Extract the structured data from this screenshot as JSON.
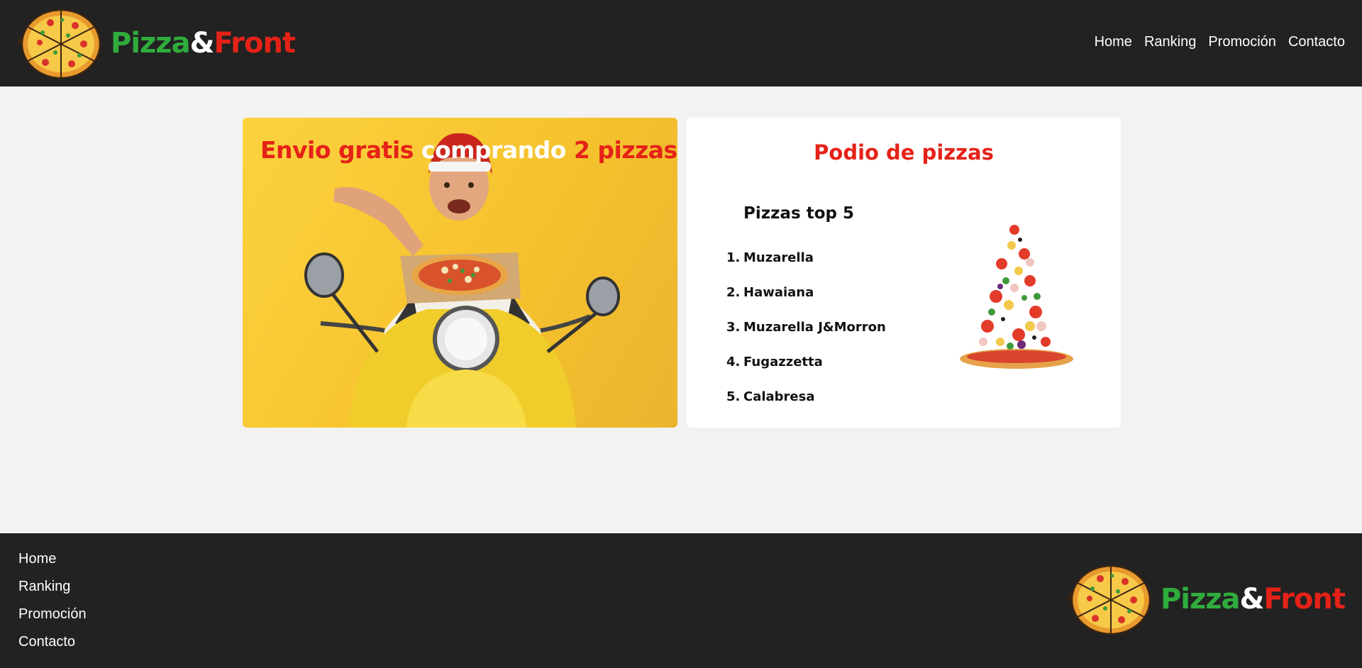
{
  "brand": {
    "part1": "Pizza",
    "part2": "&",
    "part3": "Front"
  },
  "nav": [
    {
      "label": "Home"
    },
    {
      "label": "Ranking"
    },
    {
      "label": "Promoción"
    },
    {
      "label": "Contacto"
    }
  ],
  "promo": {
    "part1": "Envio gratis ",
    "part2": "comprando",
    "part3": " 2 pizzas"
  },
  "podium": {
    "title": "Podio de pizzas",
    "heading": "Pizzas top 5",
    "items": [
      {
        "num": "1.",
        "label": "Muzarella"
      },
      {
        "num": "2.",
        "label": "Hawaiana"
      },
      {
        "num": "3.",
        "label": "Muzarella J&Morron"
      },
      {
        "num": "4.",
        "label": "Fugazzetta"
      },
      {
        "num": "5.",
        "label": "Calabresa"
      }
    ]
  },
  "footer": {
    "nav": [
      {
        "label": "Home"
      },
      {
        "label": "Ranking"
      },
      {
        "label": "Promoción"
      },
      {
        "label": "Contacto"
      }
    ]
  },
  "colors": {
    "dark": "#222222",
    "green": "#2fac3c",
    "red": "#e52218",
    "yellow": "#f6c32e",
    "background": "#f2f2f2"
  },
  "icons": {
    "logo": "pizza-logo-icon",
    "promo_image": "delivery-scooter-image",
    "podium_image": "flying-pizza-ingredients-image"
  }
}
